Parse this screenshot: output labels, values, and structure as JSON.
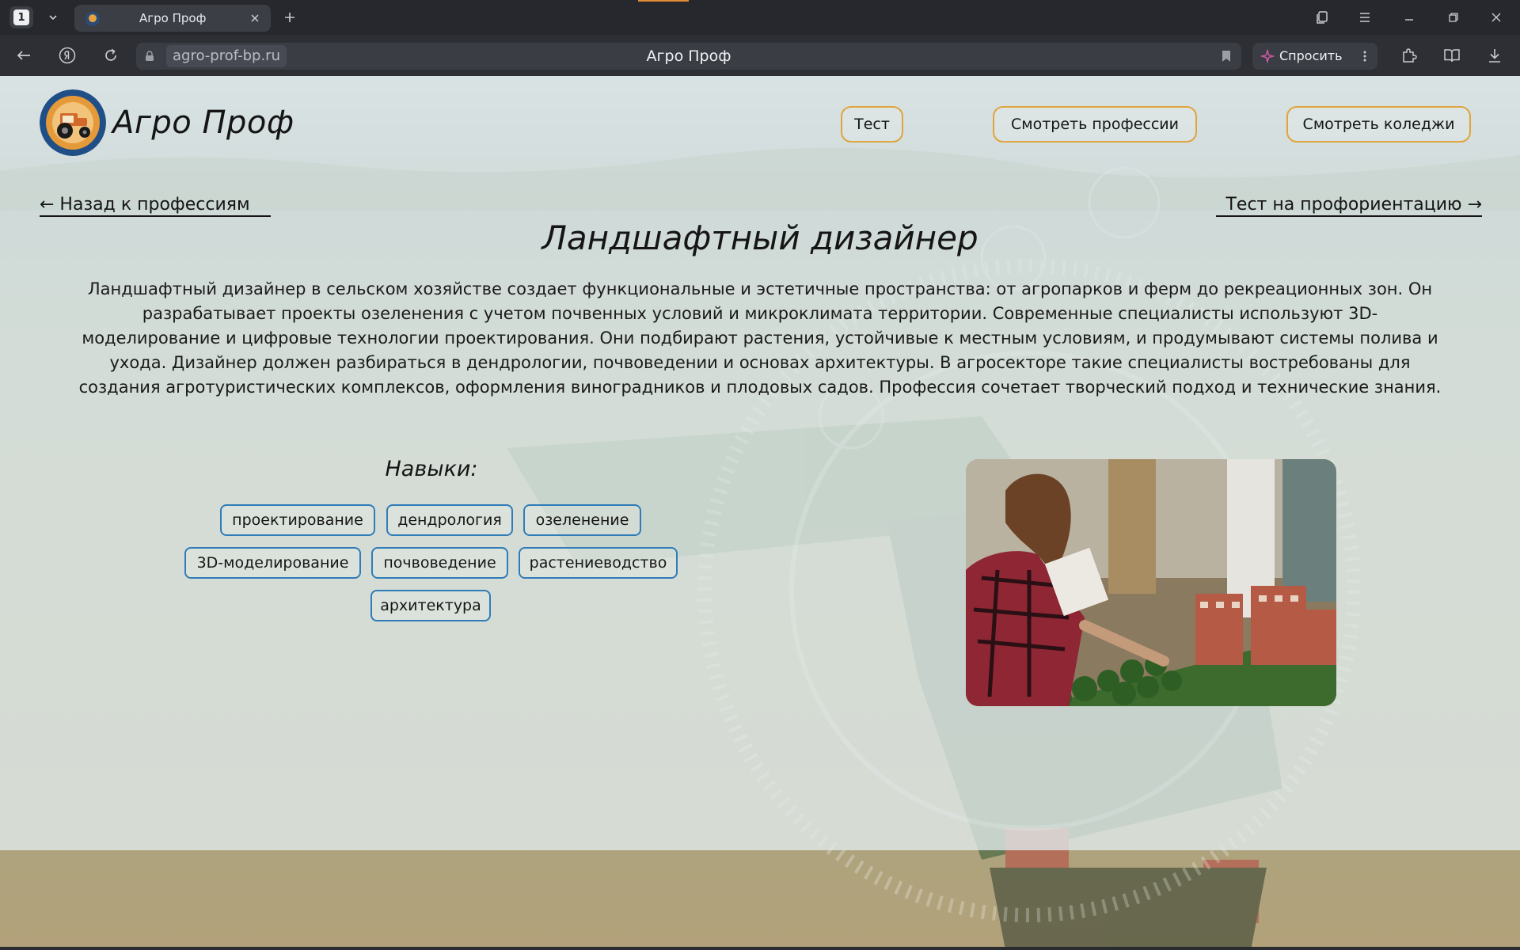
{
  "browser": {
    "tab_count": "1",
    "tab_title": "Агро Проф",
    "url": "agro-prof-bp.ru",
    "page_title": "Агро Проф",
    "ask_label": "Спросить"
  },
  "site": {
    "brand": "Агро Проф",
    "nav": {
      "test": "Тест",
      "professions": "Смотреть профессии",
      "colleges": "Смотреть коледжи"
    },
    "back_link": "← Назад к профессиям",
    "test_link": "Тест на профориентацию →"
  },
  "profession": {
    "title": "Ландшафтный дизайнер",
    "description": "Ландшафтный дизайнер в сельском хозяйстве создает функциональные и эстетичные пространства: от агропарков и ферм до рекреационных зон. Он разрабатывает проекты озеленения с учетом почвенных условий и микроклимата территории. Современные специалисты используют 3D-моделирование и цифровые технологии проектирования. Они подбирают растения, устойчивые к местным условиям, и продумывают системы полива и ухода. Дизайнер должен разбираться в дендрологии, почвоведении и основах архитектуры. В агросекторе такие специалисты востребованы для создания агротуристических комплексов, оформления виноградников и плодовых садов. Профессия сочетает творческий подход и технические знания.",
    "skills_heading": "Навыки:",
    "skills": [
      "проектирование",
      "дендрология",
      "озеленение",
      "3D-моделирование",
      "почвоведение",
      "растениеводство",
      "архитектура"
    ]
  },
  "colors": {
    "nav_border": "#e0a43c",
    "chip_border": "#2f7cb7",
    "chrome_bg": "#26282d"
  }
}
